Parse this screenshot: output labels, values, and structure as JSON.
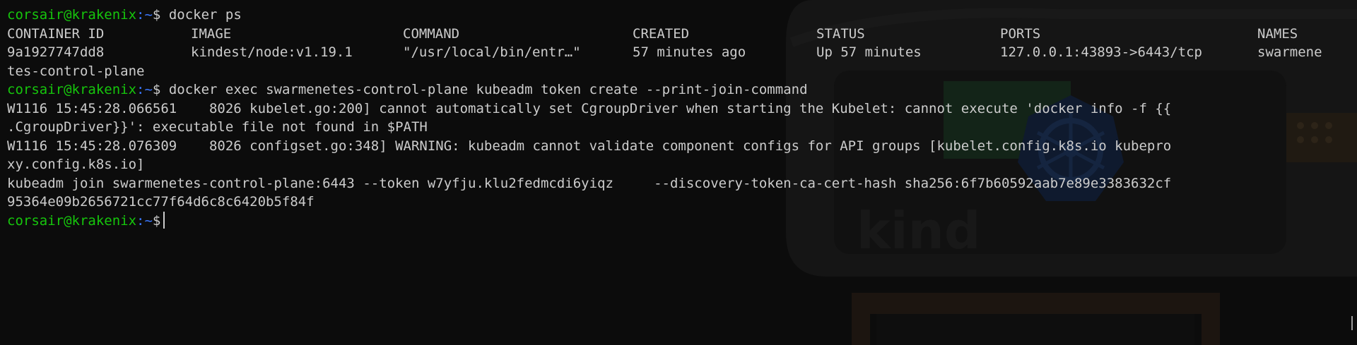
{
  "prompt": {
    "user_host": "corsair@krakenix",
    "path": ":~",
    "symbol": "$"
  },
  "commands": {
    "cmd1": "docker ps",
    "cmd2": "docker exec swarmenetes-control-plane kubeadm token create --print-join-command"
  },
  "docker_ps": {
    "headers": [
      "CONTAINER ID",
      "IMAGE",
      "COMMAND",
      "CREATED",
      "STATUS",
      "PORTS",
      "NAMES"
    ],
    "row": [
      "9a1927747dd8",
      "kindest/node:v1.19.1",
      "\"/usr/local/bin/entr…\"",
      "57 minutes ago",
      "Up 57 minutes",
      "127.0.0.1:43893->6443/tcp",
      "swarmene"
    ],
    "row_wrap": "tes-control-plane"
  },
  "output": {
    "w1_a": "W1116 15:45:28.066561    8026 kubelet.go:200] cannot automatically set CgroupDriver when starting the Kubelet: cannot execute 'docker info -f {{",
    "w1_b": ".CgroupDriver}}': executable file not found in $PATH",
    "w2_a": "W1116 15:45:28.076309    8026 configset.go:348] WARNING: kubeadm cannot validate component configs for API groups [kubelet.config.k8s.io kubepro",
    "w2_b": "xy.config.k8s.io]",
    "join_a": "kubeadm join swarmenetes-control-plane:6443 --token w7yfju.klu2fedmcdi6yiqz     --discovery-token-ca-cert-hash sha256:6f7b60592aab7e89e3383632cf",
    "join_b": "95364e09b2656721cc77f64d6c8c6420b5f84f"
  },
  "background": {
    "logo_text": "kind",
    "logo_icon": "kind-container-ship-icon"
  },
  "colors": {
    "background": "#0c0c0c",
    "foreground": "#cccccc",
    "prompt_user": "#16c60c",
    "prompt_path": "#3b78ff"
  }
}
